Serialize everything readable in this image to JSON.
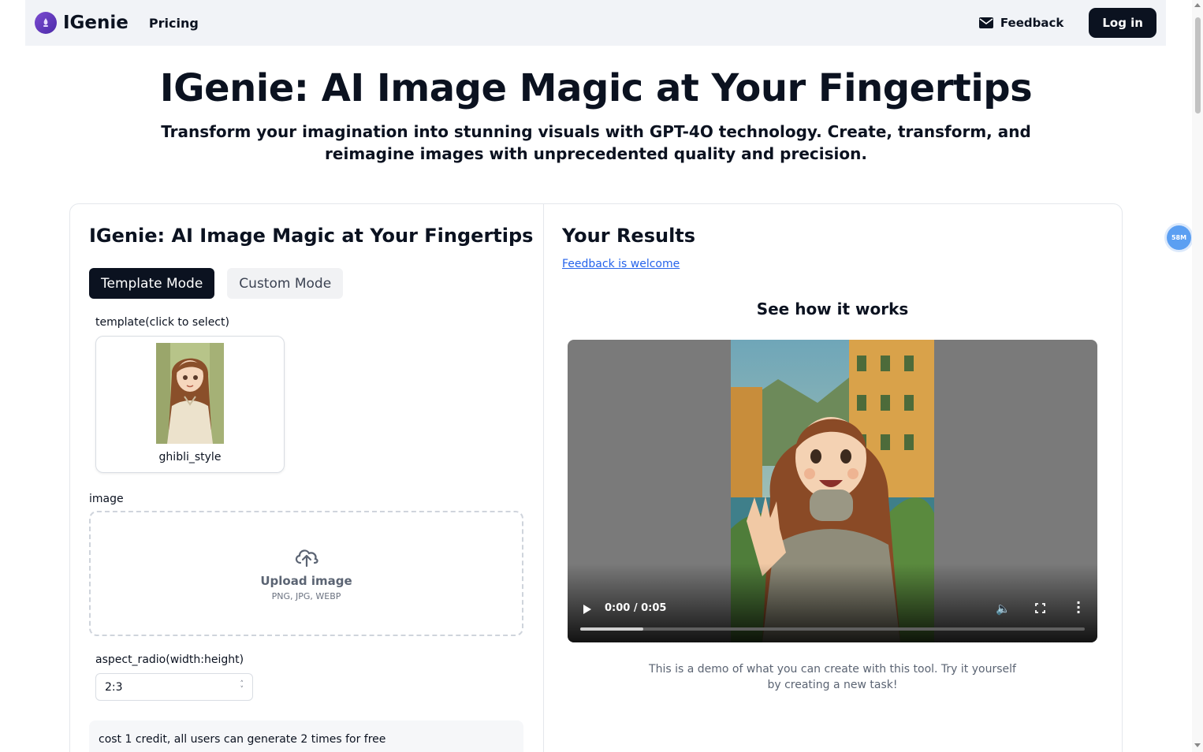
{
  "navbar": {
    "brand": "IGenie",
    "logo_icon": "genie-lamp-logo",
    "pricing_label": "Pricing",
    "feedback_label": "Feedback",
    "feedback_icon": "mail-icon",
    "login_label": "Log in"
  },
  "hero": {
    "title": "IGenie: AI Image Magic at Your Fingertips",
    "subtitle": "Transform your imagination into stunning visuals with GPT-4O technology. Create, transform, and reimagine images with unprecedented quality and precision."
  },
  "form": {
    "title": "IGenie: AI Image Magic at Your Fingertips",
    "tabs": [
      {
        "label": "Template Mode",
        "active": true
      },
      {
        "label": "Custom Mode",
        "active": false
      }
    ],
    "template_label": "template(click to select)",
    "templates": [
      {
        "name": "ghibli_style"
      }
    ],
    "image_label": "image",
    "upload_title": "Upload image",
    "upload_formats": "PNG, JPG, WEBP",
    "aspect_label": "aspect_radio(width:height)",
    "aspect_value": "2:3",
    "cost_note": "cost 1 credit, all users can generate 2 times for free"
  },
  "results": {
    "title": "Your Results",
    "feedback_link": "Feedback is welcome",
    "see_how": "See how it works",
    "video": {
      "time": "0:00 / 0:05",
      "progress": 0.125
    },
    "demo_note": "This is a demo of what you can create with this tool. Try it yourself by creating a new task!"
  },
  "floating_badge": "58M",
  "colors": {
    "primary": "#0b1220",
    "link": "#2563eb",
    "navbar_bg": "#f1f3f7",
    "badge": "#5b9ff2"
  }
}
